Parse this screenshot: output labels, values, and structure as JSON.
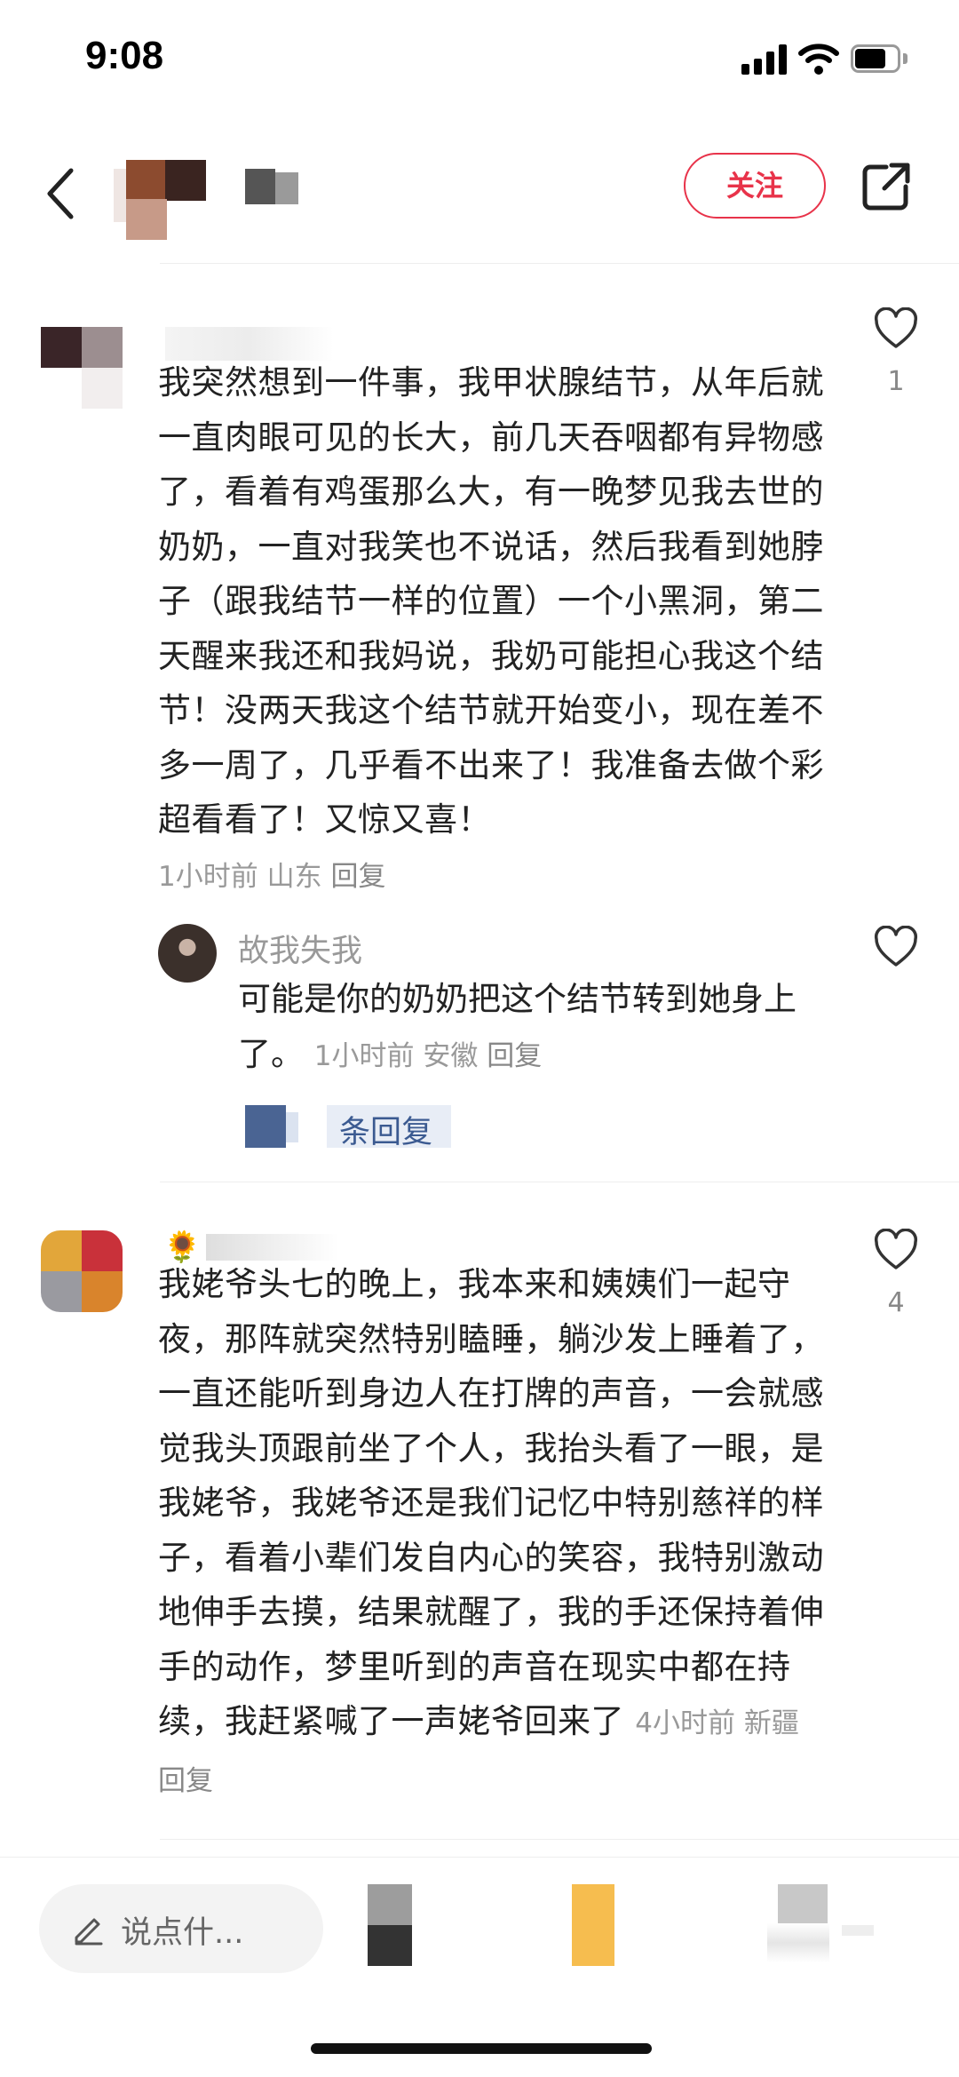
{
  "status": {
    "time": "9:08"
  },
  "header": {
    "follow_label": "关注"
  },
  "comments": [
    {
      "text": "我突然想到一件事，我甲状腺结节，从年后就一直肉眼可见的长大，前几天吞咽都有异物感了，看着有鸡蛋那么大，有一晚梦见我去世的奶奶，一直对我笑也不说话，然后我看到她脖子（跟我结节一样的位置）一个小黑洞，第二天醒来我还和我妈说，我奶可能担心我这个结节！没两天我这个结节就开始变小，现在差不多一周了，几乎看不出来了！我准备去做个彩超看看了！又惊又喜！",
      "time": "1小时前",
      "location": "山东",
      "reply_label": "回复",
      "likes": "1",
      "sub_reply": {
        "username": "故我失我",
        "text": "可能是你的奶奶把这个结节转到她身上了。",
        "time": "1小时前",
        "location": "安徽",
        "reply_label": "回复"
      },
      "expand_label": "条回复"
    },
    {
      "text": "我姥爷头七的晚上，我本来和姨姨们一起守夜，那阵就突然特别瞌睡，躺沙发上睡着了，一直还能听到身边人在打牌的声音，一会就感觉我头顶跟前坐了个人，我抬头看了一眼，是我姥爷，我姥爷还是我们记忆中特别慈祥的样子，看着小辈们发自内心的笑容，我特别激动地伸手去摸，结果就醒了，我的手还保持着伸手的动作，梦里听到的声音在现实中都在持续，我赶紧喊了一声姥爷回来了",
      "time": "4小时前",
      "location": "新疆",
      "reply_label": "回复",
      "likes": "4"
    }
  ],
  "bottom_bar": {
    "input_placeholder": "说点什..."
  },
  "colors": {
    "accent": "#e8334a",
    "meta": "#999999",
    "link": "#3b5a91"
  },
  "icons": [
    "back-icon",
    "share-icon",
    "heart-icon",
    "pencil-icon",
    "signal-icon",
    "wifi-icon",
    "battery-icon"
  ]
}
